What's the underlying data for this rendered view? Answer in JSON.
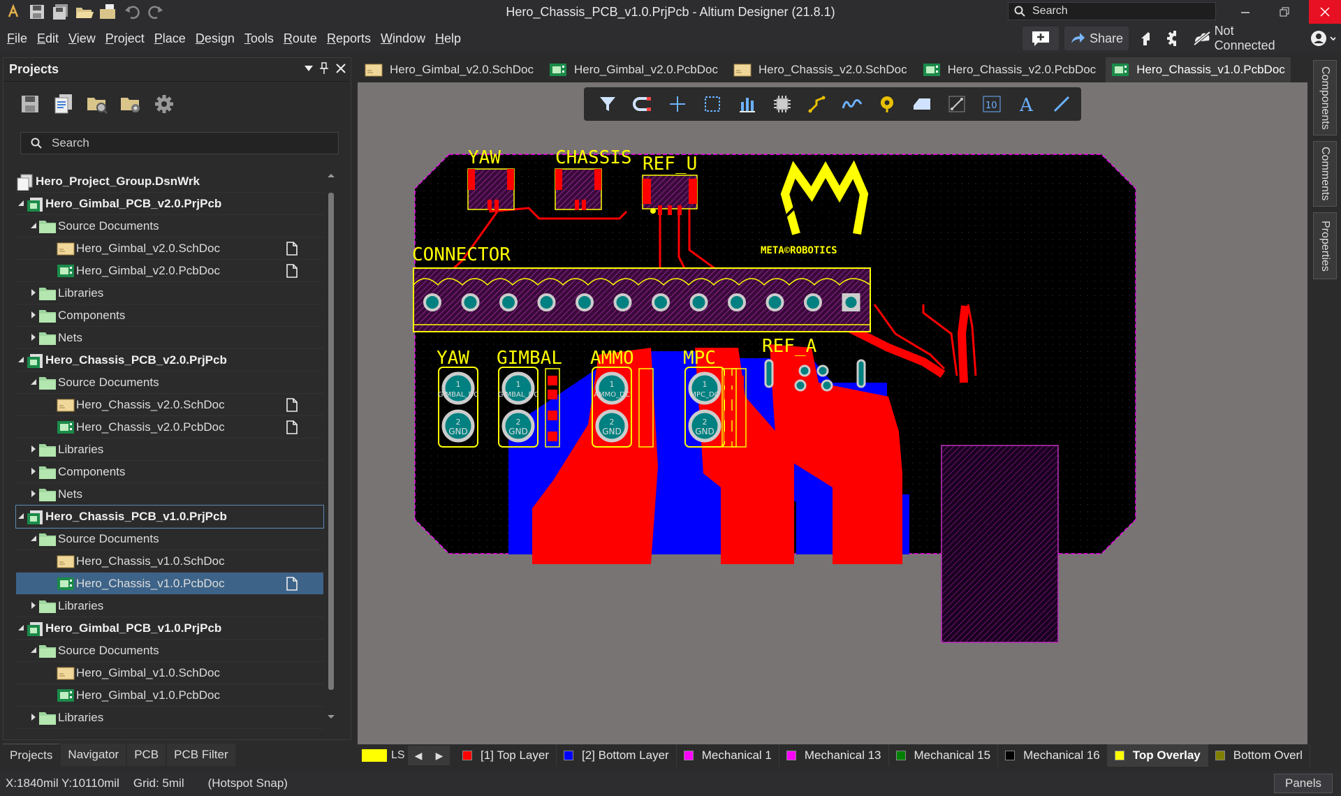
{
  "window": {
    "title": "Hero_Chassis_PCB_v1.0.PrjPcb - Altium Designer (21.8.1)",
    "search_placeholder": "Search"
  },
  "menu": [
    "File",
    "Edit",
    "View",
    "Project",
    "Place",
    "Design",
    "Tools",
    "Route",
    "Reports",
    "Window",
    "Help"
  ],
  "menu_right": {
    "share_label": "Share",
    "connection_label": "Not Connected"
  },
  "projects_panel": {
    "title": "Projects",
    "search_placeholder": "Search",
    "tree": [
      {
        "label": "Hero_Project_Group.DsnWrk",
        "level": 0,
        "type": "group",
        "bold": true
      },
      {
        "label": "Hero_Gimbal_PCB_v2.0.PrjPcb",
        "level": 0,
        "type": "project",
        "bold": true,
        "expanded": true
      },
      {
        "label": "Source Documents",
        "level": 1,
        "type": "folder",
        "expanded": true
      },
      {
        "label": "Hero_Gimbal_v2.0.SchDoc",
        "level": 2,
        "type": "sch",
        "doc": true
      },
      {
        "label": "Hero_Gimbal_v2.0.PcbDoc",
        "level": 2,
        "type": "pcb",
        "doc": true
      },
      {
        "label": "Libraries",
        "level": 1,
        "type": "folder",
        "expanded": false
      },
      {
        "label": "Components",
        "level": 1,
        "type": "folder",
        "expanded": false
      },
      {
        "label": "Nets",
        "level": 1,
        "type": "folder",
        "expanded": false
      },
      {
        "label": "Hero_Chassis_PCB_v2.0.PrjPcb",
        "level": 0,
        "type": "project",
        "bold": true,
        "expanded": true
      },
      {
        "label": "Source Documents",
        "level": 1,
        "type": "folder",
        "expanded": true
      },
      {
        "label": "Hero_Chassis_v2.0.SchDoc",
        "level": 2,
        "type": "sch",
        "doc": true
      },
      {
        "label": "Hero_Chassis_v2.0.PcbDoc",
        "level": 2,
        "type": "pcb",
        "doc": true
      },
      {
        "label": "Libraries",
        "level": 1,
        "type": "folder",
        "expanded": false
      },
      {
        "label": "Components",
        "level": 1,
        "type": "folder",
        "expanded": false
      },
      {
        "label": "Nets",
        "level": 1,
        "type": "folder",
        "expanded": false
      },
      {
        "label": "Hero_Chassis_PCB_v1.0.PrjPcb",
        "level": 0,
        "type": "project",
        "bold": true,
        "expanded": true,
        "outlined": true
      },
      {
        "label": "Source Documents",
        "level": 1,
        "type": "folder",
        "expanded": true
      },
      {
        "label": "Hero_Chassis_v1.0.SchDoc",
        "level": 2,
        "type": "sch"
      },
      {
        "label": "Hero_Chassis_v1.0.PcbDoc",
        "level": 2,
        "type": "pcb",
        "doc": true,
        "selected": true
      },
      {
        "label": "Libraries",
        "level": 1,
        "type": "folder",
        "expanded": false
      },
      {
        "label": "Hero_Gimbal_PCB_v1.0.PrjPcb",
        "level": 0,
        "type": "project",
        "bold": true,
        "expanded": true
      },
      {
        "label": "Source Documents",
        "level": 1,
        "type": "folder",
        "expanded": true
      },
      {
        "label": "Hero_Gimbal_v1.0.SchDoc",
        "level": 2,
        "type": "sch"
      },
      {
        "label": "Hero_Gimbal_v1.0.PcbDoc",
        "level": 2,
        "type": "pcb"
      },
      {
        "label": "Libraries",
        "level": 1,
        "type": "folder",
        "expanded": false
      }
    ],
    "tabs": [
      "Projects",
      "Navigator",
      "PCB",
      "PCB Filter"
    ]
  },
  "doc_tabs": [
    {
      "label": "Hero_Gimbal_v2.0.SchDoc",
      "type": "sch"
    },
    {
      "label": "Hero_Gimbal_v2.0.PcbDoc",
      "type": "pcb"
    },
    {
      "label": "Hero_Chassis_v2.0.SchDoc",
      "type": "sch"
    },
    {
      "label": "Hero_Chassis_v2.0.PcbDoc",
      "type": "pcb"
    },
    {
      "label": "Hero_Chassis_v1.0.PcbDoc",
      "type": "pcb",
      "active": true
    }
  ],
  "side_tabs": [
    "Components",
    "Comments",
    "Properties"
  ],
  "pcb": {
    "silk_labels": {
      "yaw_top": "YAW",
      "chassis": "CHASSIS",
      "ref_u": "REF_U",
      "connector": "CONNECTOR",
      "ref_a": "REF_A",
      "yaw": "YAW",
      "gimbal": "GIMBAL",
      "ammo": "AMMO",
      "mpc": "MPC",
      "logo_text": "META©ROBOTICS"
    },
    "pad_labels": {
      "yaw_pin1": "GIMBAL_DC",
      "gimbal_pin1": "GIMBAL_DC",
      "ammo_pin1": "AMMO_DC",
      "mpc_pin1": "MPC_DC",
      "gnd": "GND",
      "one": "1",
      "two": "2"
    },
    "colors": {
      "board": "#000000",
      "top_layer": "#ff0000",
      "bottom_layer": "#0000ff",
      "top_overlay": "#ffff00",
      "pad": "#008080",
      "mechanical": "#c000c0"
    }
  },
  "layers": {
    "ls_label": "LS",
    "items": [
      {
        "label": "[1] Top Layer",
        "color": "#ff0000"
      },
      {
        "label": "[2] Bottom Layer",
        "color": "#0000ff"
      },
      {
        "label": "Mechanical 1",
        "color": "#ff00ff"
      },
      {
        "label": "Mechanical 13",
        "color": "#ff00ff"
      },
      {
        "label": "Mechanical 15",
        "color": "#008000"
      },
      {
        "label": "Mechanical 16",
        "color": "#000000"
      },
      {
        "label": "Top Overlay",
        "color": "#ffff00",
        "active": true
      },
      {
        "label": "Bottom Overl",
        "color": "#808000"
      }
    ]
  },
  "status": {
    "coords": "X:1840mil Y:10110mil",
    "grid": "Grid: 5mil",
    "snap": "(Hotspot Snap)",
    "panels_label": "Panels"
  }
}
